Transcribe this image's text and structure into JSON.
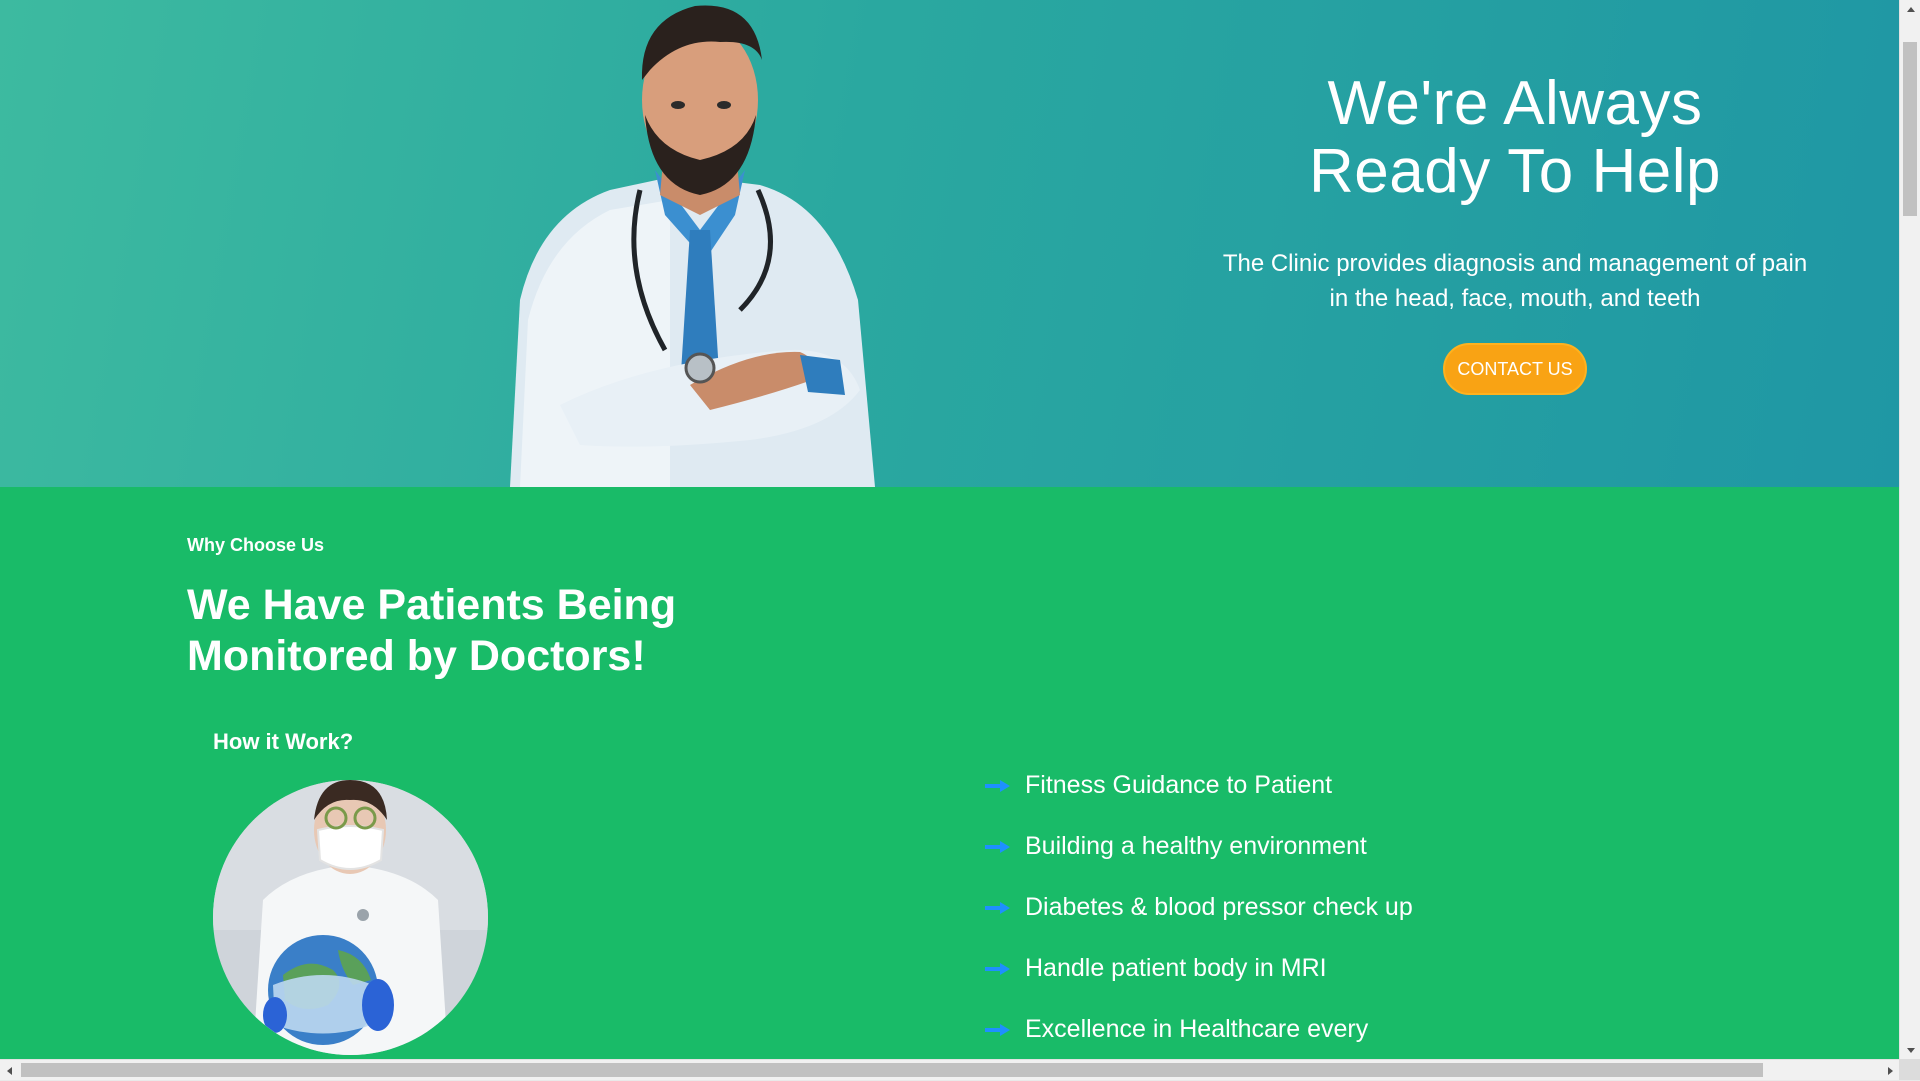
{
  "hero": {
    "title_line1": "We're Always",
    "title_line2": "Ready To Help",
    "subtitle": "The Clinic provides diagnosis and management of pain in the head, face, mouth, and teeth",
    "cta_label": "CONTACT US"
  },
  "why": {
    "eyebrow": "Why Choose Us",
    "title_line1": "We Have Patients Being",
    "title_line2": "Monitored by Doctors!",
    "how_title": "How it Work?",
    "features": [
      "Fitness Guidance to Patient",
      "Building a healthy environment",
      "Diabetes & blood pressor check up",
      "Handle patient body in MRI",
      "Excellence in Healthcare every"
    ]
  },
  "icons": {
    "feature_arrow": "arrow-right-icon",
    "doctor_image": "doctor-image",
    "nurse_image": "nurse-image"
  },
  "colors": {
    "hero_gradient_start": "#3dbaa0",
    "hero_gradient_end": "#1f97a4",
    "section_green": "#19bb68",
    "cta_orange": "#f9a314",
    "arrow_blue": "#1e90ff"
  }
}
